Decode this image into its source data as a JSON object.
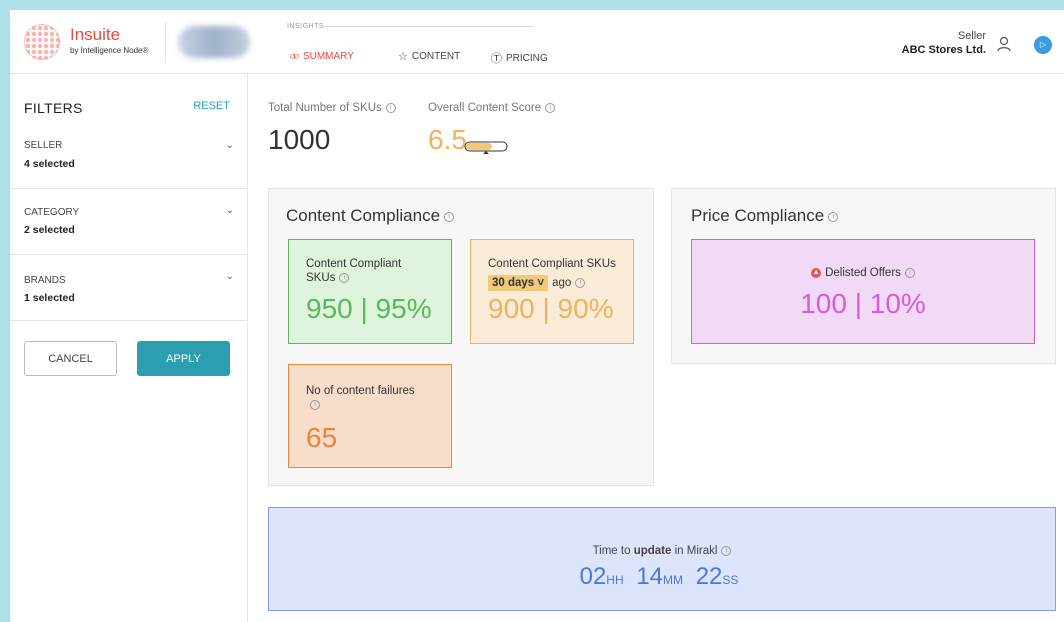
{
  "header": {
    "logo": {
      "brand": "Insuite",
      "tagline": "by Intelligence Node®"
    },
    "nav": {
      "section": "INSIGHTS",
      "tabs": [
        {
          "label": "SUMMARY",
          "icon": "summary-icon",
          "active": true
        },
        {
          "label": "CONTENT",
          "icon": "star-icon",
          "active": false
        },
        {
          "label": "PRICING",
          "icon": "dollar-icon",
          "active": false
        }
      ]
    },
    "seller": {
      "label": "Seller",
      "name": "ABC Stores Ltd."
    }
  },
  "sidebar": {
    "title": "FILTERS",
    "reset": "RESET",
    "groups": [
      {
        "label": "SELLER",
        "value": "4 selected"
      },
      {
        "label": "CATEGORY",
        "value": "2 selected"
      },
      {
        "label": "BRANDS",
        "value": "1 selected"
      }
    ],
    "cancel": "CANCEL",
    "apply": "APPLY"
  },
  "stats": {
    "skus_label": "Total Number of SKUs",
    "skus_value": "1000",
    "score_label": "Overall Content Score",
    "score_value": "6.5"
  },
  "content_compliance": {
    "title": "Content Compliance",
    "compliant": {
      "label": "Content Compliant SKUs",
      "value": "950 | 95%"
    },
    "compliant_ago": {
      "label": "Content Compliant SKUs",
      "days": "30 days",
      "suffix": "ago",
      "value": "900 | 90%"
    },
    "failures": {
      "label": "No of content failures",
      "value": "65"
    }
  },
  "price_compliance": {
    "title": "Price Compliance",
    "delisted": {
      "label": "Delisted Offers",
      "value": "100 | 10%"
    }
  },
  "timer": {
    "prefix": "Time to",
    "bold": "update",
    "suffix": "in Mirakl",
    "hh": "02",
    "hh_unit": "HH",
    "mm": "14",
    "mm_unit": "MM",
    "ss": "22",
    "ss_unit": "SS"
  },
  "colors": {
    "brand": "#e94b3c",
    "accent": "#2b9fb0",
    "green": "#5bb85b",
    "amber": "#f0b25a",
    "orange": "#e8873a",
    "magenta": "#d75cd6",
    "blue": "#4a78e0"
  }
}
